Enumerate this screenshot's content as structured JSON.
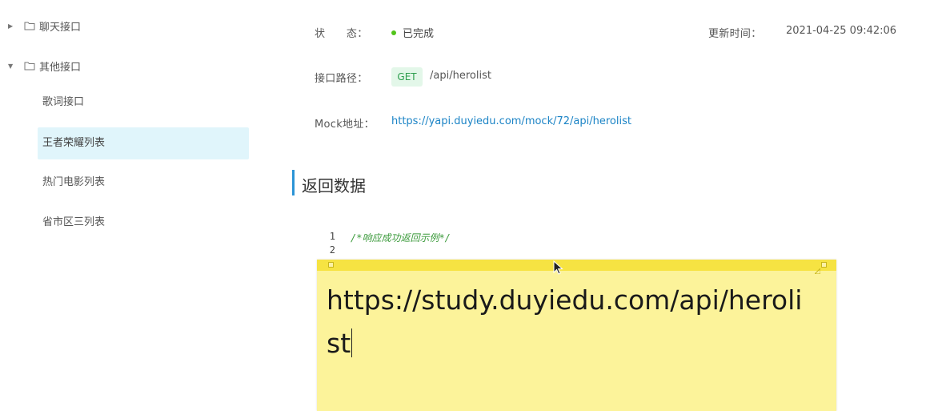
{
  "sidebar": {
    "groups": [
      {
        "label": "聊天接口",
        "expanded": false,
        "icon": "folder-icon"
      },
      {
        "label": "其他接口",
        "expanded": true,
        "icon": "folder-icon"
      }
    ],
    "items": [
      {
        "label": "歌词接口",
        "active": false
      },
      {
        "label": "王者荣耀列表",
        "active": true
      },
      {
        "label": "热门电影列表",
        "active": false
      },
      {
        "label": "省市区三列表",
        "active": false
      }
    ]
  },
  "info": {
    "status_label": "状　　态：",
    "status_value": "已完成",
    "status_color": "#52c41a",
    "update_label": "更新时间：",
    "update_value": "2021-04-25 09:42:06",
    "path_label": "接口路径：",
    "method": "GET",
    "path": "/api/herolist",
    "mock_label": "Mock地址：",
    "mock_url": "https://yapi.duyiedu.com/mock/72/api/herolist"
  },
  "section": {
    "title": "返回数据"
  },
  "code": {
    "lines": [
      "1",
      "2"
    ],
    "comment": "/*响应成功返回示例*/"
  },
  "sticky_note": {
    "text": "https://study.duyiedu.com/api/herolist"
  },
  "colors": {
    "accent": "#2b94d6",
    "link": "#1c84c6",
    "sticky": "#fcf39a",
    "active_item": "#e0f5fb"
  }
}
